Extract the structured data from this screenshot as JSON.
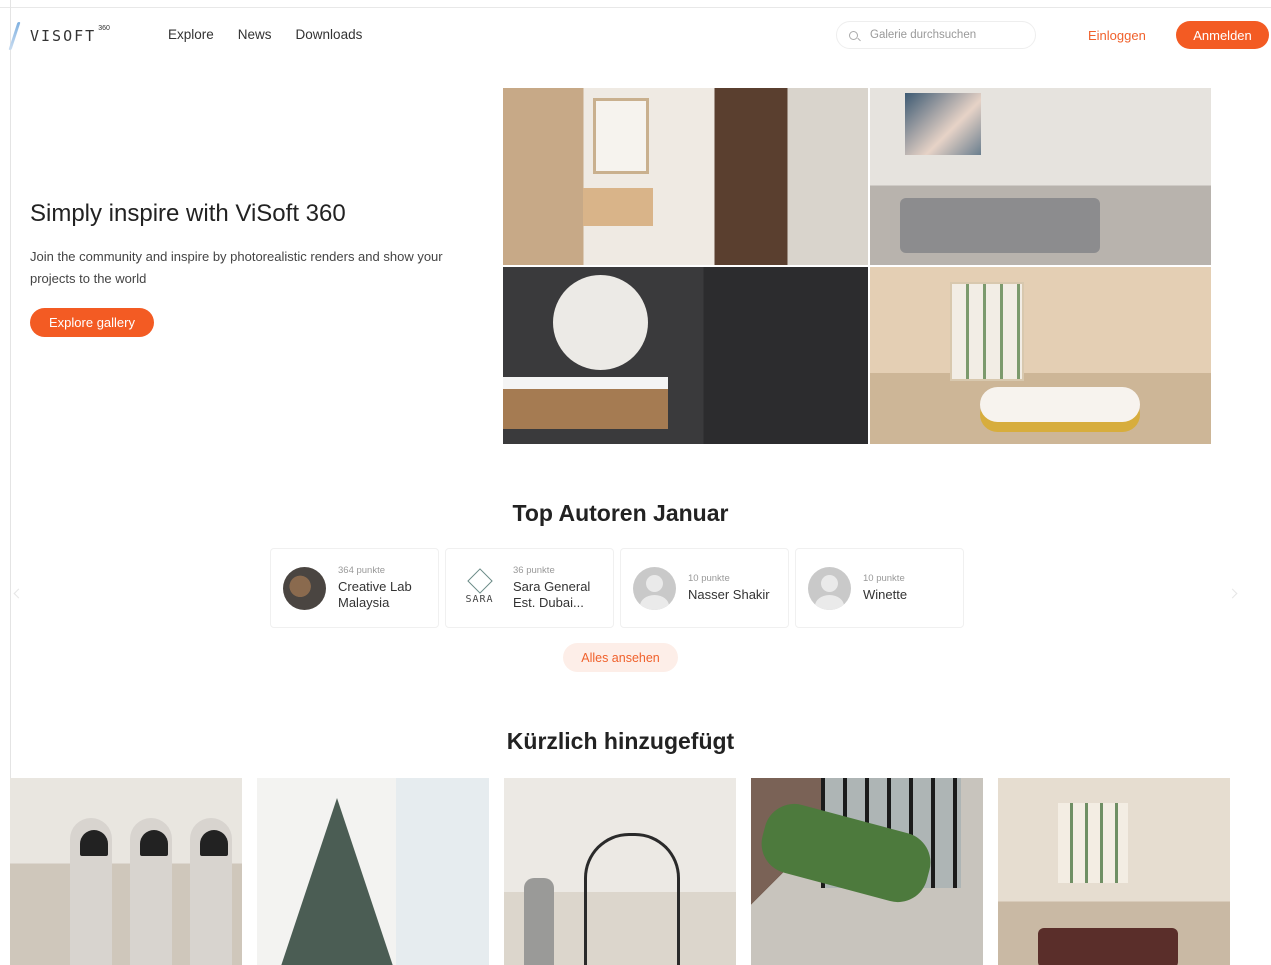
{
  "brand": {
    "logo_text": "VISOFT",
    "logo_sup": "360"
  },
  "nav": {
    "items": [
      "Explore",
      "News",
      "Downloads"
    ]
  },
  "search": {
    "placeholder": "Galerie durchsuchen"
  },
  "auth": {
    "login_label": "Einloggen",
    "signup_label": "Anmelden"
  },
  "hero": {
    "title": "Simply inspire with ViSoft 360",
    "subtitle": "Join the community and inspire by photorealistic renders and show your projects to the world",
    "cta_label": "Explore gallery"
  },
  "authors": {
    "title": "Top Autoren Januar",
    "items": [
      {
        "points": "364 punkte",
        "name": "Creative Lab Malaysia",
        "avatar": "photo"
      },
      {
        "points": "36 punkte",
        "name": "Sara General Est. Dubai...",
        "avatar": "sara-logo",
        "avatar_text": "SARA"
      },
      {
        "points": "10 punkte",
        "name": "Nasser Shakir",
        "avatar": "default-user"
      },
      {
        "points": "10 punkte",
        "name": "Winette",
        "avatar": "default-user"
      }
    ],
    "see_all_label": "Alles ansehen"
  },
  "recent": {
    "title": "Kürzlich hinzugefügt"
  },
  "colors": {
    "accent": "#f35b23",
    "accent_soft": "#fdeee8"
  }
}
